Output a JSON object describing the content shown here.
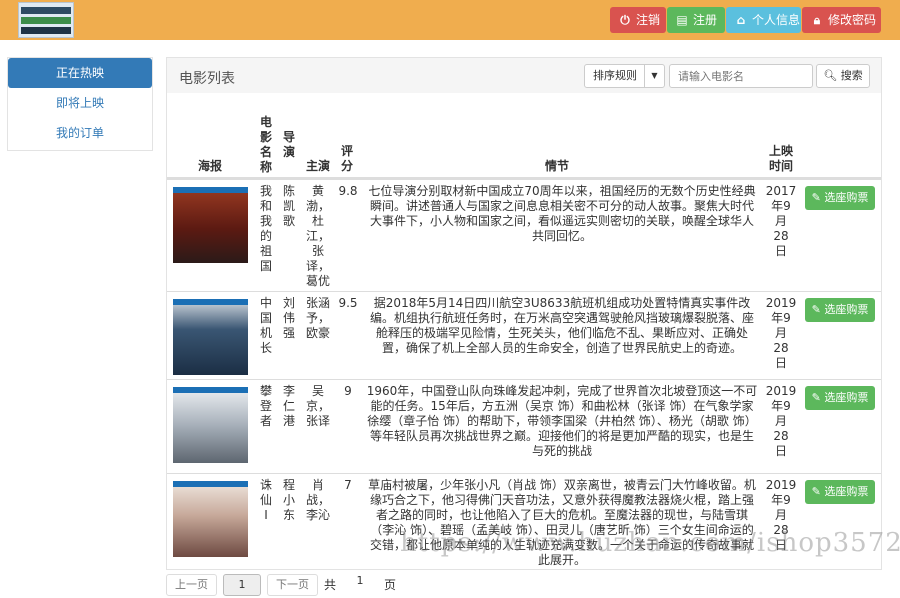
{
  "header": {
    "buttons": [
      {
        "label": "注销",
        "icon": "power-icon"
      },
      {
        "label": "注册",
        "icon": "id-card-icon"
      },
      {
        "label": "个人信息",
        "icon": "home-icon"
      },
      {
        "label": "修改密码",
        "icon": "lock-icon"
      }
    ]
  },
  "sidebar": {
    "items": [
      {
        "label": "正在热映",
        "active": true
      },
      {
        "label": "即将上映",
        "active": false
      },
      {
        "label": "我的订单",
        "active": false
      }
    ]
  },
  "panel": {
    "title": "电影列表",
    "sort_label": "排序规则",
    "search_placeholder": "请输入电影名",
    "search_button": "搜索"
  },
  "table": {
    "headers": {
      "poster": "海报",
      "name": "电\n影\n名\n称",
      "director": "导\n演",
      "actors": "主演",
      "rating": "评\n分",
      "plot": "情节",
      "release": "上映\n时间"
    },
    "buy_label": "选座购票",
    "rows": [
      {
        "name": "我\n和\n我\n的\n祖\n国",
        "director": "陈\n凯\n歌",
        "actors": "黄\n渤，\n杜\n江，\n张\n译，\n葛优",
        "rating": "9.8",
        "plot": "七位导演分别取材新中国成立70周年以来，祖国经历的无数个历史性经典瞬间。讲述普通人与国家之间息息相关密不可分的动人故事。聚焦大时代大事件下，小人物和国家之间，看似遥远实则密切的关联，唤醒全球华人共同回忆。",
        "release": "2017\n年9\n月\n28\n日",
        "poster_color": "#7a2a1c"
      },
      {
        "name": "中\n国\n机\n长",
        "director": "刘\n伟\n强",
        "actors": "张涵\n予，\n欧豪",
        "rating": "9.5",
        "plot": "据2018年5月14日四川航空3U8633航班机组成功处置特情真实事件改编。机组执行航班任务时，在万米高空突遇驾驶舱风挡玻璃爆裂脱落、座舱释压的极端罕见险情，生死关头，他们临危不乱、果断应对、正确处置，确保了机上全部人员的生命安全，创造了世界民航史上的奇迹。",
        "release": "2019\n年9\n月\n28\n日",
        "poster_color": "#1f3f5e"
      },
      {
        "name": "攀\n登\n者",
        "director": "李\n仁\n港",
        "actors": "吴\n京，\n张译",
        "rating": "9",
        "plot": "1960年，中国登山队向珠峰发起冲刺，完成了世界首次北坡登顶这一不可能的任务。15年后，方五洲（吴京 饰）和曲松林（张译 饰）在气象学家徐缨（章子怡 饰）的帮助下，带领李国梁（井柏然 饰）、杨光（胡歌 饰）等年轻队员再次挑战世界之巅。迎接他们的将是更加严酷的现实，也是生与死的挑战",
        "release": "2019\n年9\n月\n28\n日",
        "poster_color": "#8d97a3"
      },
      {
        "name": "诛\n仙\nⅠ",
        "director": "程\n小\n东",
        "actors": "肖\n战，\n李沁",
        "rating": "7",
        "plot": "草庙村被屠，少年张小凡（肖战 饰）双亲离世，被青云门大竹峰收留。机缘巧合之下，他习得佛门天音功法，又意外获得魔教法器烧火棍，踏上强者之路的同时，也让他陷入了巨大的危机。至魔法器的现世，与陆雪琪（李沁 饰）、碧瑶（孟美岐 饰）、田灵儿（唐艺昕 饰）三个女生间命运的交错，都让他原本单纯的人生轨迹充满变数。一个关于命运的传奇故事就此展开。",
        "release": "2019\n年9\n月\n28\n日",
        "poster_color": "#c9b7aa"
      }
    ]
  },
  "pagination": {
    "prev": "上一页",
    "current": "1",
    "next": "下一页",
    "total_prefix": "共",
    "total_value": "1",
    "total_suffix": "页"
  },
  "watermark": "https://www.huzhan.com/ishop3572"
}
